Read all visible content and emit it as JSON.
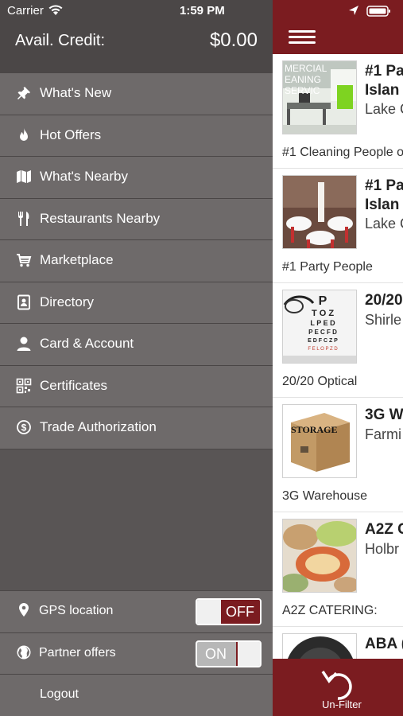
{
  "status": {
    "carrier": "Carrier",
    "time": "1:59 PM"
  },
  "drawer": {
    "credit_label": "Avail. Credit:",
    "credit_value": "$0.00",
    "menu": [
      {
        "label": "What's New",
        "icon": "pin-icon"
      },
      {
        "label": "Hot Offers",
        "icon": "flame-icon"
      },
      {
        "label": "What's Nearby",
        "icon": "map-icon"
      },
      {
        "label": "Restaurants Nearby",
        "icon": "fork-knife-icon"
      },
      {
        "label": "Marketplace",
        "icon": "cart-icon"
      },
      {
        "label": "Directory",
        "icon": "contact-book-icon"
      },
      {
        "label": "Card & Account",
        "icon": "person-icon"
      },
      {
        "label": "Certificates",
        "icon": "qr-code-icon"
      },
      {
        "label": "Trade Authorization",
        "icon": "dollar-circle-icon"
      }
    ],
    "gps_label": "GPS location",
    "gps_toggle": "OFF",
    "partner_label": "Partner offers",
    "partner_toggle": "ON",
    "logout_label": "Logout"
  },
  "listings": [
    {
      "title_l1": "#1 Pa",
      "title_l2": "Islan",
      "sub": "Lake C",
      "caption": "#1 Cleaning People o",
      "thumb_text": "MERCIAL EANING SERVIC"
    },
    {
      "title_l1": "#1 Pa",
      "title_l2": "Islan",
      "sub": "Lake C",
      "caption": "#1 Party People"
    },
    {
      "title_l1": "20/20",
      "sub": "Shirle",
      "caption": "20/20 Optical"
    },
    {
      "title_l1": "3G W",
      "sub": "Farmi",
      "caption": "3G Warehouse",
      "thumb_text": "STORAGE"
    },
    {
      "title_l1": "A2Z C",
      "sub": "Holbr",
      "caption": "A2Z CATERING:"
    },
    {
      "title_l1": "ABA ("
    }
  ],
  "eyechart_lines": [
    "P",
    "T O Z",
    "L P E D",
    "P E C F D",
    "E D F C Z P",
    "F E L O P Z D"
  ],
  "bottom_bar": {
    "unfilter_label": "Un-Filter"
  },
  "colors": {
    "brand": "#7b1c20",
    "drawer": "#595555"
  }
}
